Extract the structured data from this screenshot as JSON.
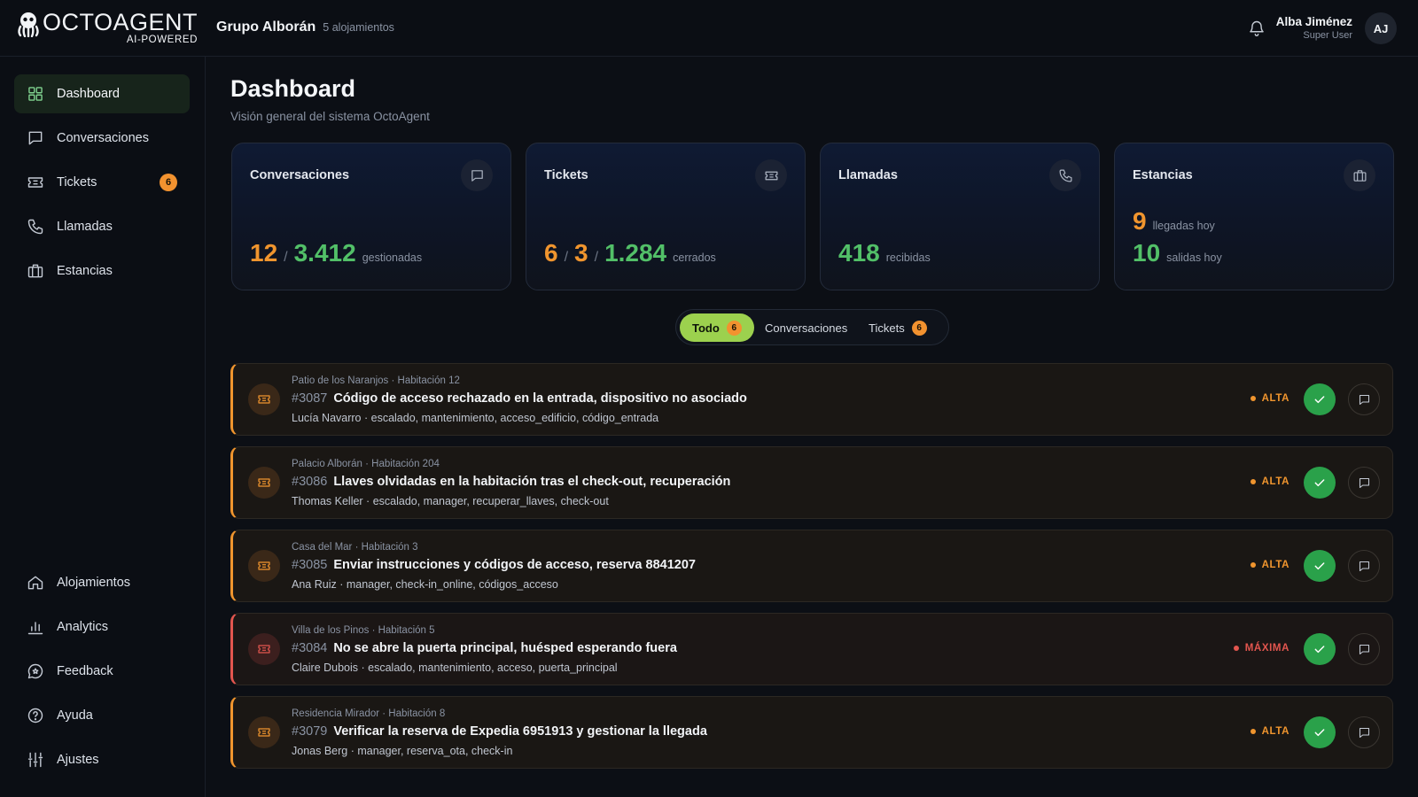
{
  "brand": {
    "name": "OCTOAGENT",
    "tagline": "AI-POWERED"
  },
  "org": {
    "name": "Grupo Alborán",
    "count": "5 alojamientos"
  },
  "user": {
    "name": "Alba Jiménez",
    "role": "Super User",
    "initials": "AJ"
  },
  "sidebar": {
    "top": [
      {
        "label": "Dashboard",
        "icon": "grid-icon",
        "active": true
      },
      {
        "label": "Conversaciones",
        "icon": "message-icon"
      },
      {
        "label": "Tickets",
        "icon": "ticket-icon",
        "badge": "6"
      },
      {
        "label": "Llamadas",
        "icon": "phone-icon"
      },
      {
        "label": "Estancias",
        "icon": "luggage-icon"
      }
    ],
    "bottom": [
      {
        "label": "Alojamientos",
        "icon": "home-icon"
      },
      {
        "label": "Analytics",
        "icon": "bar-chart-icon"
      },
      {
        "label": "Feedback",
        "icon": "feedback-icon"
      },
      {
        "label": "Ayuda",
        "icon": "help-icon"
      },
      {
        "label": "Ajustes",
        "icon": "sliders-icon"
      }
    ]
  },
  "page": {
    "title": "Dashboard",
    "subtitle": "Visión general del sistema OctoAgent"
  },
  "cards": {
    "conversaciones": {
      "title": "Conversaciones",
      "active": "12",
      "total": "3.412",
      "unit": "gestionadas",
      "icon": "message-icon"
    },
    "tickets": {
      "title": "Tickets",
      "open": "6",
      "pending": "3",
      "closed": "1.284",
      "unit": "cerrados",
      "icon": "ticket-icon"
    },
    "llamadas": {
      "title": "Llamadas",
      "value": "418",
      "unit": "recibidas",
      "icon": "phone-icon"
    },
    "estancias": {
      "title": "Estancias",
      "arrivals": "9",
      "arrivals_unit": "llegadas hoy",
      "departures": "10",
      "departures_unit": "salidas hoy",
      "icon": "luggage-icon"
    }
  },
  "filters": {
    "todo": {
      "label": "Todo",
      "badge": "6"
    },
    "conversaciones": {
      "label": "Conversaciones"
    },
    "tickets": {
      "label": "Tickets",
      "badge": "6"
    }
  },
  "tickets": [
    {
      "location": "Patio de los Naranjos · Habitación 12",
      "id": "#3087",
      "title": "Código de acceso rechazado en la entrada, dispositivo no asociado",
      "meta": "Lucía Navarro · escalado, mantenimiento, acceso_edificio, código_entrada",
      "priority": "ALTA",
      "level": "alta"
    },
    {
      "location": "Palacio Alborán · Habitación 204",
      "id": "#3086",
      "title": "Llaves olvidadas en la habitación tras el check-out, recuperación",
      "meta": "Thomas Keller · escalado, manager, recuperar_llaves, check-out",
      "priority": "ALTA",
      "level": "alta"
    },
    {
      "location": "Casa del Mar · Habitación 3",
      "id": "#3085",
      "title": "Enviar instrucciones y códigos de acceso, reserva 8841207",
      "meta": "Ana Ruiz · manager, check-in_online, códigos_acceso",
      "priority": "ALTA",
      "level": "alta"
    },
    {
      "location": "Villa de los Pinos · Habitación 5",
      "id": "#3084",
      "title": "No se abre la puerta principal, huésped esperando fuera",
      "meta": "Claire Dubois · escalado, mantenimiento, acceso, puerta_principal",
      "priority": "MÁXIMA",
      "level": "max"
    },
    {
      "location": "Residencia Mirador · Habitación 8",
      "id": "#3079",
      "title": "Verificar la reserva de Expedia 6951913 y gestionar la llegada",
      "meta": "Jonas Berg · manager, reserva_ota, check-in",
      "priority": "ALTA",
      "level": "alta"
    }
  ]
}
